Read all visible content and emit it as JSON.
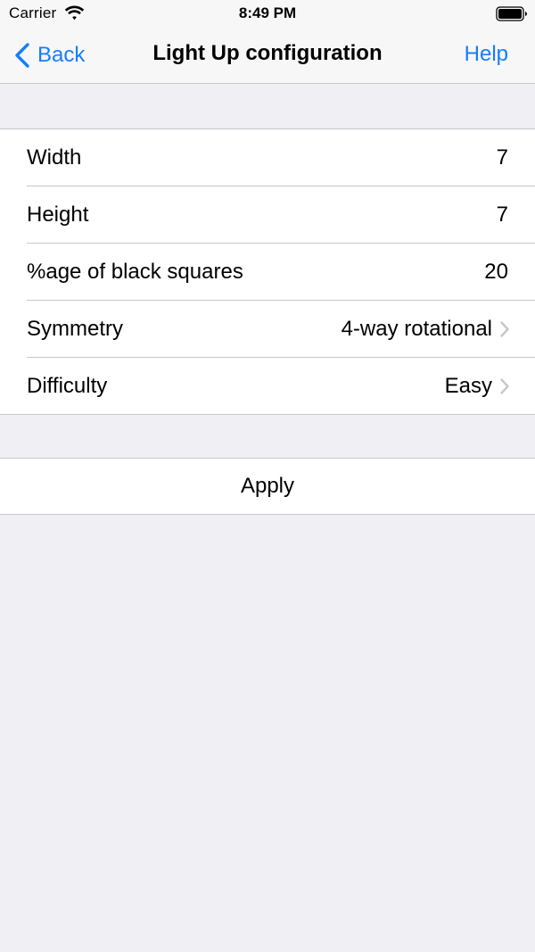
{
  "status_bar": {
    "carrier": "Carrier",
    "time": "8:49 PM",
    "wifi_icon": "wifi-icon",
    "battery_icon": "battery-icon"
  },
  "nav": {
    "back_label": "Back",
    "title": "Light Up configuration",
    "help_label": "Help",
    "tint_color": "#157efb"
  },
  "settings": {
    "rows": [
      {
        "label": "Width",
        "value": "7"
      },
      {
        "label": "Height",
        "value": "7"
      },
      {
        "label": "%age of black squares",
        "value": "20"
      },
      {
        "label": "Symmetry",
        "value": "4-way rotational"
      },
      {
        "label": "Difficulty",
        "value": "Easy"
      }
    ]
  },
  "apply": {
    "label": "Apply"
  },
  "colors": {
    "background": "#efeff4",
    "separator": "#c8c7cc",
    "chevron": "#c7c7cc"
  }
}
